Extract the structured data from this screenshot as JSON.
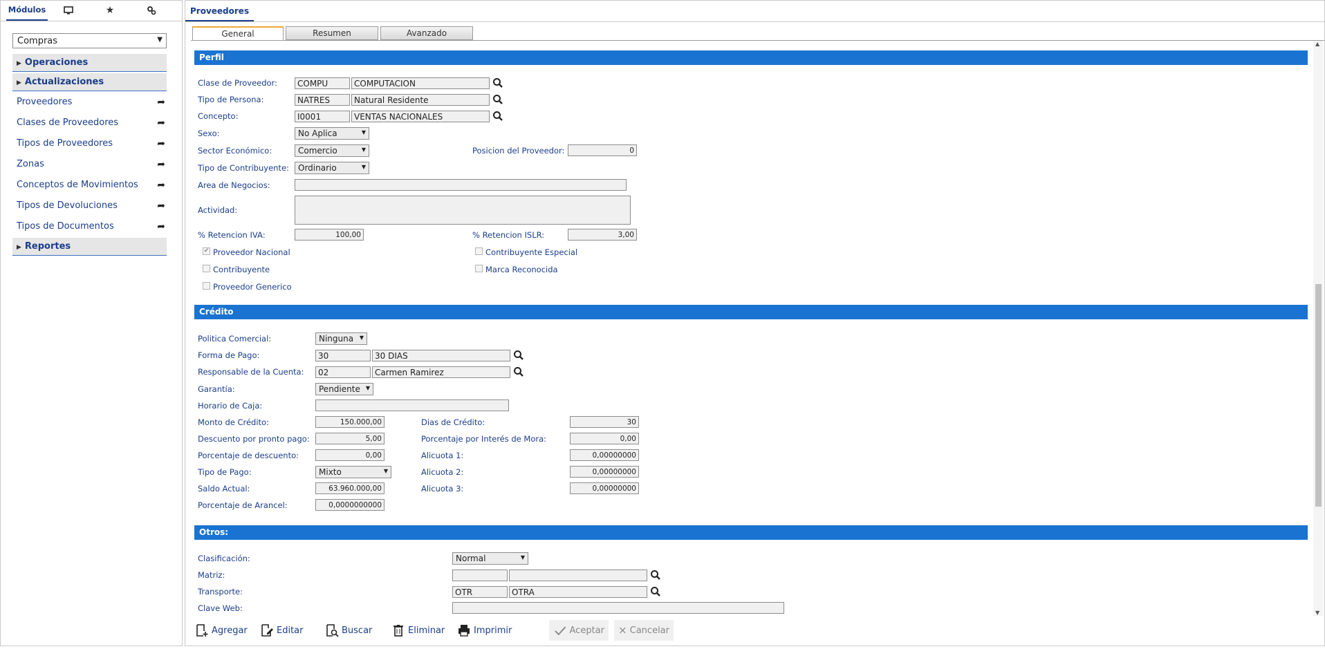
{
  "left": {
    "tabs": [
      {
        "label": "Módulos"
      },
      {
        "icon": "monitor-icon"
      },
      {
        "icon": "star-icon"
      },
      {
        "icon": "settings-icon"
      }
    ],
    "module_select": "Compras",
    "groups": {
      "operaciones": "Operaciones",
      "actualizaciones": "Actualizaciones",
      "reportes": "Reportes"
    },
    "items": [
      "Proveedores",
      "Clases de Proveedores",
      "Tipos de Proveedores",
      "Zonas",
      "Conceptos de Movimientos",
      "Tipos de Devoluciones",
      "Tipos de Documentos"
    ]
  },
  "main": {
    "title": "Proveedores",
    "subtabs": [
      "General",
      "Resumen",
      "Avanzado"
    ],
    "perfil": {
      "title": "Perfil",
      "clase_label": "Clase de Proveedor:",
      "clase_code": "COMPU",
      "clase_desc": "COMPUTACION",
      "persona_label": "Tipo de Persona:",
      "persona_code": "NATRES",
      "persona_desc": "Natural Residente",
      "concepto_label": "Concepto:",
      "concepto_code": "I0001",
      "concepto_desc": "VENTAS NACIONALES",
      "sexo_label": "Sexo:",
      "sexo": "No Aplica",
      "sector_label": "Sector Económico:",
      "sector": "Comercio",
      "posicion_label": "Posicion del Proveedor:",
      "posicion": "0",
      "contribuyente_tipo_label": "Tipo de Contribuyente:",
      "contribuyente_tipo": "Ordinario",
      "area_label": "Area de Negocios:",
      "area": "",
      "actividad_label": "Actividad:",
      "actividad": "",
      "ret_iva_label": "% Retencion IVA:",
      "ret_iva": "100,00",
      "ret_islr_label": "% Retencion ISLR:",
      "ret_islr": "3,00",
      "chk_nacional": "Proveedor Nacional",
      "chk_contribuyente": "Contribuyente",
      "chk_generico": "Proveedor Generico",
      "chk_especial": "Contribuyente Especial",
      "chk_marca": "Marca Reconocida"
    },
    "credito": {
      "title": "Crédito",
      "politica_label": "Politica Comercial:",
      "politica": "Ninguna",
      "forma_label": "Forma de Pago:",
      "forma_code": "30",
      "forma_desc": "30 DIAS",
      "resp_label": "Responsable de la Cuenta:",
      "resp_code": "02",
      "resp_desc": "Carmen Ramirez",
      "garantia_label": "Garantía:",
      "garantia": "Pendiente",
      "horario_label": "Horario de Caja:",
      "horario": "",
      "monto_label": "Monto de Crédito:",
      "monto": "150.000,00",
      "descuento_pp_label": "Descuento por pronto pago:",
      "descuento_pp": "5,00",
      "porc_desc_label": "Porcentaje de descuento:",
      "porc_desc": "0,00",
      "tipo_pago_label": "Tipo de Pago:",
      "tipo_pago": "Mixto",
      "saldo_label": "Saldo Actual:",
      "saldo": "63.960.000,00",
      "arancel_label": "Porcentaje de Arancel:",
      "arancel": "0,0000000000",
      "dias_label": "Dias de Crédito:",
      "dias": "30",
      "mora_label": "Porcentaje por Interés de Mora:",
      "mora": "0,00",
      "alic1_label": "Alicuota 1:",
      "alic1": "0,00000000",
      "alic2_label": "Alicuota 2:",
      "alic2": "0,00000000",
      "alic3_label": "Alicuota 3:",
      "alic3": "0,00000000"
    },
    "otros": {
      "title": "Otros:",
      "clasif_label": "Clasificación:",
      "clasif": "Normal",
      "matriz_label": "Matriz:",
      "matriz_code": "",
      "matriz_desc": "",
      "transp_label": "Transporte:",
      "transp_code": "OTR",
      "transp_desc": "OTRA",
      "clave_label": "Clave Web:",
      "clave": ""
    }
  },
  "toolbar": {
    "agregar": "Agregar",
    "editar": "Editar",
    "buscar": "Buscar",
    "eliminar": "Eliminar",
    "imprimir": "Imprimir",
    "aceptar": "Aceptar",
    "cancelar": "Cancelar"
  }
}
